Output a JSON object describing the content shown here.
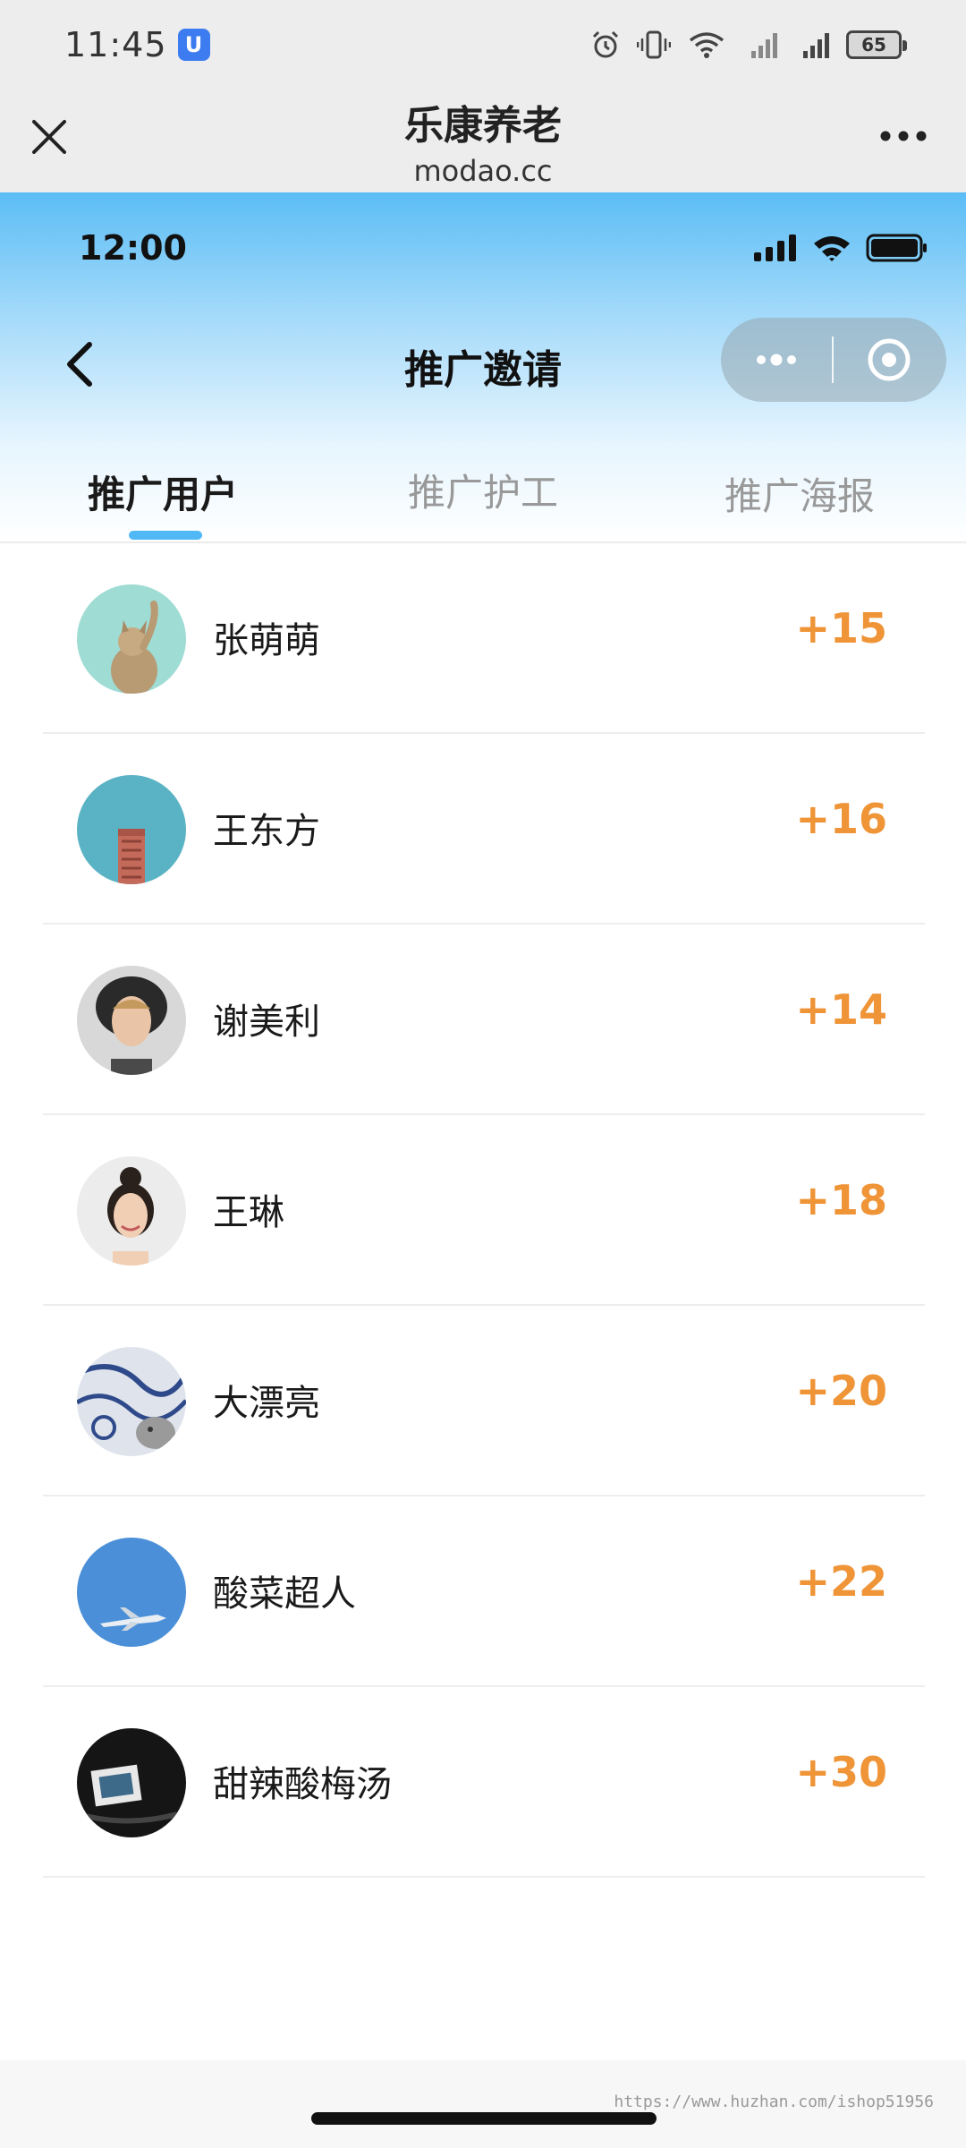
{
  "system_status": {
    "time": "11:45",
    "app_badge": "U",
    "battery": "65"
  },
  "browser": {
    "title": "乐康养老",
    "subtitle": "modao.cc"
  },
  "inner_status": {
    "time": "12:00"
  },
  "nav": {
    "title": "推广邀请"
  },
  "tabs": [
    {
      "label": "推广用户",
      "active": true
    },
    {
      "label": "推广护工",
      "active": false
    },
    {
      "label": "推广海报",
      "active": false
    }
  ],
  "users": [
    {
      "name": "张萌萌",
      "score": "+15",
      "avatar": "cat-avatar"
    },
    {
      "name": "王东方",
      "score": "+16",
      "avatar": "building-avatar"
    },
    {
      "name": "谢美利",
      "score": "+14",
      "avatar": "man-avatar"
    },
    {
      "name": "王琳",
      "score": "+18",
      "avatar": "woman-avatar"
    },
    {
      "name": "大漂亮",
      "score": "+20",
      "avatar": "pattern-cat-avatar"
    },
    {
      "name": "酸菜超人",
      "score": "+22",
      "avatar": "airplane-avatar"
    },
    {
      "name": "甜辣酸梅汤",
      "score": "+30",
      "avatar": "dark-photo-avatar"
    }
  ],
  "watermark": "https://www.huzhan.com/ishop51956",
  "colors": {
    "accent_blue": "#4fb8f5",
    "score_orange": "#ef9437"
  }
}
